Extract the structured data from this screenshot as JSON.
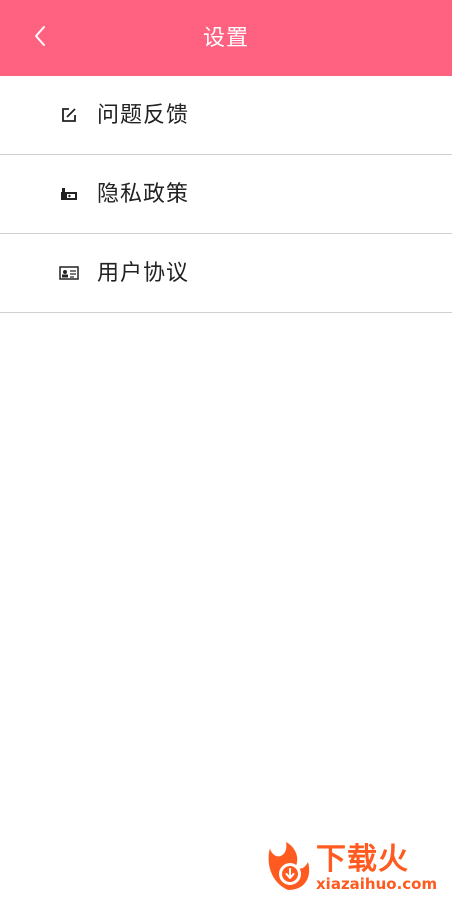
{
  "header": {
    "title": "设置",
    "back_icon": "chevron-left-icon",
    "background_color": "#ff6180"
  },
  "menu": {
    "items": [
      {
        "label": "问题反馈",
        "icon": "edit-icon"
      },
      {
        "label": "隐私政策",
        "icon": "privacy-icon"
      },
      {
        "label": "用户协议",
        "icon": "id-card-icon"
      }
    ]
  },
  "watermark": {
    "brand": "下载火",
    "domain": "xiazaihuo.com",
    "color": "#ff5a1f"
  }
}
